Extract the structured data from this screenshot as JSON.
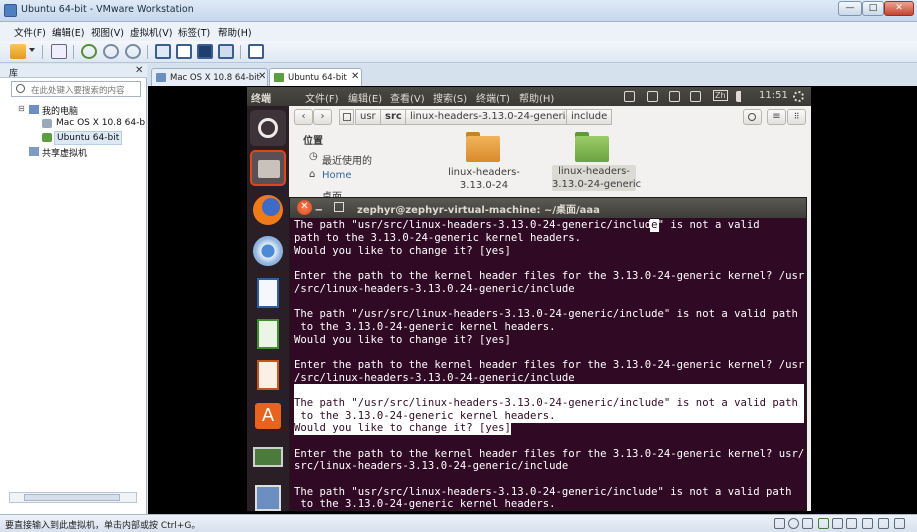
{
  "window": {
    "title": "Ubuntu 64-bit - VMware Workstation",
    "min_label": "—",
    "max_label": "□",
    "close_label": "✕"
  },
  "menubar": [
    "文件(F)",
    "编辑(E)",
    "视图(V)",
    "虚拟机(V)",
    "标签(T)",
    "帮助(H)"
  ],
  "library": {
    "title": "库",
    "close": "✕",
    "search_placeholder": "在此处键入要搜索的内容",
    "tree": {
      "root": "我的电脑",
      "items": [
        "Mac OS X 10.8 64-b",
        "Ubuntu 64-bit"
      ],
      "shared": "共享虚拟机"
    }
  },
  "tabs": [
    {
      "label": "Mac OS X 10.8 64-bit",
      "close": "✕"
    },
    {
      "label": "Ubuntu 64-bit",
      "close": "✕"
    }
  ],
  "ubuntu_panel": {
    "app": "终端",
    "menus": [
      "文件(F)",
      "编辑(E)",
      "查看(V)",
      "搜索(S)",
      "终端(T)",
      "帮助(H)"
    ],
    "time": "11:51",
    "ime": "Zh"
  },
  "launcher_icons": [
    "ubuntu-logo-icon",
    "files-icon",
    "firefox-icon",
    "chromium-icon",
    "writer-icon",
    "calc-icon",
    "impress-icon",
    "software-center-icon",
    "workspace-icon",
    "trash-icon"
  ],
  "nautilus": {
    "back": "‹",
    "forward": "›",
    "breadcrumbs": [
      "usr",
      "src",
      "linux-headers-3.13.0-24-generic",
      "include"
    ],
    "places_title": "位置",
    "places": [
      "最近使用的",
      "Home",
      "桌面"
    ],
    "folders": [
      {
        "line1": "linux-headers-",
        "line2": "3.13.0-24",
        "color": "#e8a23c"
      },
      {
        "line1": "linux-headers-",
        "line2": "3.13.0-24-generic",
        "color": "#7fb84e"
      }
    ]
  },
  "terminal": {
    "title": "zephyr@zephyr-virtual-machine: ~/桌面/aaa",
    "close": "✕",
    "minimize": "‒",
    "lines": {
      "l1a": "The path \"usr/src/linux-headers-3.13.0-24-generic/includ",
      "l1cur": "e",
      "l1b": "\" is not a valid",
      "l2": "path to the 3.13.0-24-generic kernel headers.",
      "l3": "Would you like to change it? [yes]",
      "l4": "",
      "l5": "Enter the path to the kernel header files for the 3.13.0-24-generic kernel? /usr",
      "l6": "/src/linux-headers-3.13.0.24-generic/include",
      "l7": "",
      "l8": "The path \"/usr/src/linux-headers-3.13.0-24-generic/include\" is not a valid path",
      "l9": " to the 3.13.0-24-generic kernel headers.",
      "l10": "Would you like to change it? [yes]",
      "l11": "",
      "l12": "Enter the path to the kernel header files for the 3.13.0-24-generic kernel? /usr",
      "l13": "/src/linux-headers-3.13.0-24-generic/include",
      "l14": "",
      "l15": "The path \"/usr/src/linux-headers-3.13.0-24-generic/include\" is not a valid path",
      "l16": " to the 3.13.0-24-generic kernel headers.",
      "l17": "Would you like to change it? [yes]",
      "l18": "",
      "l19": "Enter the path to the kernel header files for the 3.13.0-24-generic kernel? usr/",
      "l20": "src/linux-headers-3.13.0-24-generic/include",
      "l21": "",
      "l22": "The path \"usr/src/linux-headers-3.13.0-24-generic/include\" is not a valid path",
      "l23": " to the 3.13.0-24-generic kernel headers."
    }
  },
  "statusbar": "要直接输入到此虚拟机，单击内部或按 Ctrl+G。",
  "colors": {
    "terminal_bg": "#300a24",
    "ubuntu_orange": "#dd4814",
    "vmware_blue": "#d9e4f1"
  }
}
